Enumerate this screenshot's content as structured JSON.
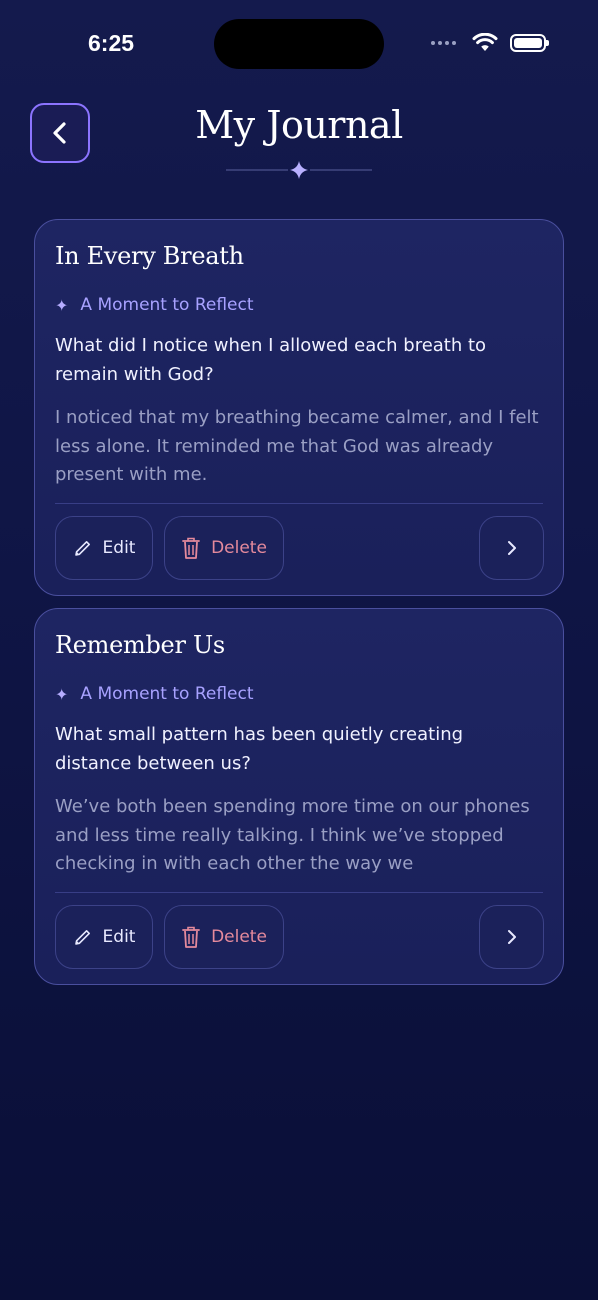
{
  "status_bar": {
    "time": "6:25"
  },
  "header": {
    "title": "My Journal",
    "back_icon": "chevron-left-icon"
  },
  "entries": [
    {
      "title": "In Every Breath",
      "eyebrow": "A Moment to Reflect",
      "prompt": "What did I notice when I allowed each breath to remain with God?",
      "body": "I noticed that my breathing became calmer, and I felt less alone. It reminded me that God was already present with me.",
      "edit_label": "Edit",
      "delete_label": "Delete"
    },
    {
      "title": "Remember Us",
      "eyebrow": "A Moment to Reflect",
      "prompt": "What small pattern has been quietly creating distance between us?",
      "body": "We’ve both been spending more time on our phones and less time really talking. I think we’ve stopped checking in with each other the way we",
      "edit_label": "Edit",
      "delete_label": "Delete"
    }
  ],
  "icons": {
    "eyebrow": "sparkle-icon",
    "edit": "pencil-icon",
    "delete": "trash-icon",
    "open": "chevron-right-icon"
  },
  "colors": {
    "background": "#10164a",
    "accent": "#8c74ff",
    "eyebrow": "#a8a2ff",
    "delete": "#e58a9c"
  }
}
